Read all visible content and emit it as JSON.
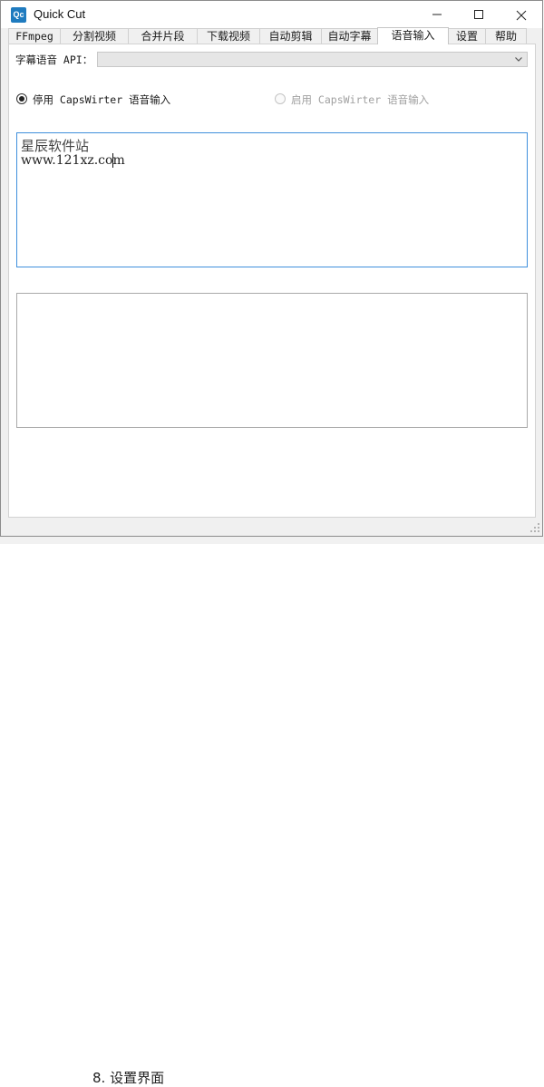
{
  "window": {
    "title": "Quick Cut",
    "icon_text": "Qc",
    "minimize_glyph": "—",
    "maximize_glyph": "☐",
    "close_glyph": "✕"
  },
  "tabs": [
    {
      "label": "FFmpeg"
    },
    {
      "label": "分割视频"
    },
    {
      "label": "合并片段"
    },
    {
      "label": "下载视频"
    },
    {
      "label": "自动剪辑"
    },
    {
      "label": "自动字幕"
    },
    {
      "label": "语音输入",
      "active": true
    },
    {
      "label": "设置"
    },
    {
      "label": "帮助"
    }
  ],
  "voice_input": {
    "api_label": "字幕语音 API：",
    "api_selected": "",
    "radio_disable_label": "停用 CapsWirter 语音输入",
    "radio_disable_checked": true,
    "radio_enable_label": "启用 CapsWirter 语音输入",
    "radio_enable_checked": false,
    "input_text_line1": "星辰软件站",
    "input_text_line2": "www.121xz.com",
    "output_text": ""
  },
  "background": {
    "bottom_text": "8. 设置界面"
  },
  "colors": {
    "focus_border": "#3f8fdc",
    "app_icon": "#1f7bbf"
  }
}
